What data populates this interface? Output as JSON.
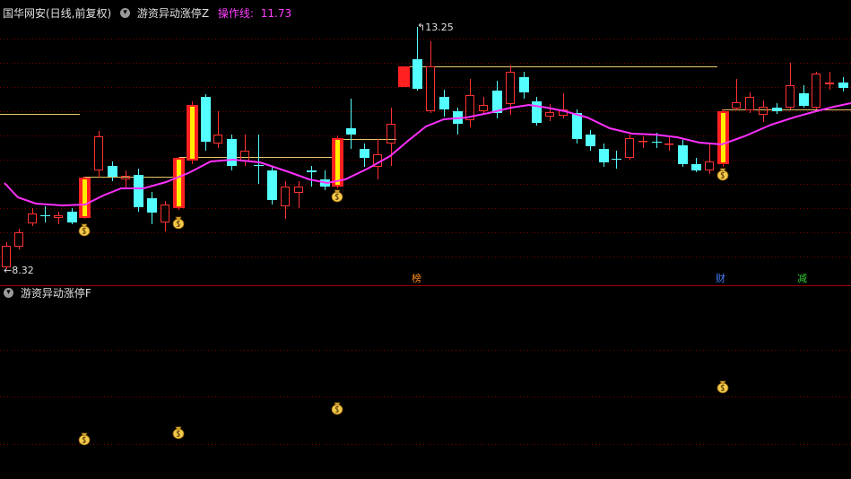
{
  "header": {
    "stock_title": "国华网安(日线,前复权)",
    "indicator_name": "游资异动涨停Z",
    "operation_line_label": "操作线:",
    "operation_line_value": "11.73"
  },
  "sub_panel": {
    "indicator_name": "游资异动涨停F"
  },
  "price_labels": {
    "high": "13.25",
    "low": "8.32"
  },
  "event_tags": [
    {
      "text": "榜",
      "color": "#ff8c1a"
    },
    {
      "text": "财",
      "color": "#4a7fff"
    },
    {
      "text": "减",
      "color": "#33cc33"
    }
  ],
  "icons": {
    "panel_toggle": "chevron-down-icon",
    "signal": "money-bag-icon"
  },
  "colors": {
    "background": "#000000",
    "up_candle": "#ff3232",
    "down_candle": "#54ffff",
    "limit_up_outer": "#ff2020",
    "limit_up_inner": "#ffee00",
    "moving_average": "#ff30ff",
    "operation_line": "#e8c66a",
    "grid": "#7a0000"
  }
}
